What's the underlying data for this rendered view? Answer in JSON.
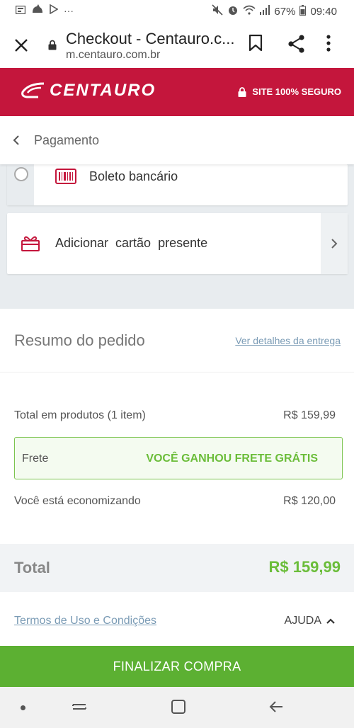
{
  "status_bar": {
    "battery": "67%",
    "time": "09:40",
    "more": "···"
  },
  "browser": {
    "title": "Checkout - Centauro.c...",
    "url": "m.centauro.com.br"
  },
  "header": {
    "brand": "CENTAURO",
    "secure_label": "SITE 100% SEGURO",
    "brand_color": "#c4163c"
  },
  "payment": {
    "title": "Pagamento",
    "boleto_label": "Boleto bancário",
    "gift_label": "Adicionar  cartão presente"
  },
  "summary": {
    "title": "Resumo do pedido",
    "details_link": "Ver detalhes da entrega",
    "products_label": "Total em produtos (1 item)",
    "products_value": "R$ 159,99",
    "shipping_label": "Frete",
    "shipping_value": "VOCÊ GANHOU FRETE GRÁTIS",
    "savings_label": "Você está economizando",
    "savings_value": "R$ 120,00",
    "total_label": "Total",
    "total_value": "R$ 159,99",
    "accent_color": "#6bbd3a"
  },
  "footer": {
    "terms_link": "Termos de Uso e Condições",
    "help_label": "AJUDA",
    "finalize_label": "FINALIZAR COMPRA"
  }
}
